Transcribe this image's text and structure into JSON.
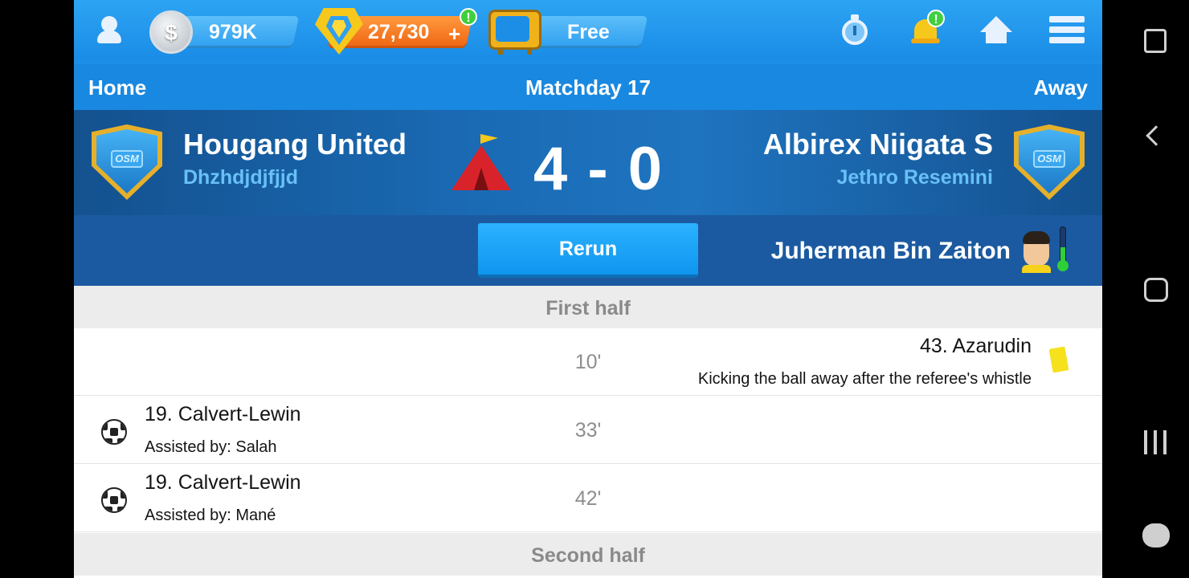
{
  "topbar": {
    "coins": "979K",
    "coin_symbol": "$",
    "gems": "27,730",
    "gems_plus": "+",
    "gems_alert": "!",
    "tv_label": "Free",
    "bell_alert": "!"
  },
  "match": {
    "home_label": "Home",
    "matchday": "Matchday 17",
    "away_label": "Away",
    "home_team": "Hougang United",
    "home_manager": "Dhzhdjdjfjjd",
    "away_team": "Albirex Niigata S",
    "away_manager": "Jethro Resemini",
    "score": "4 - 0",
    "badge_text": "OSM",
    "rerun_label": "Rerun",
    "man_of_match": "Juherman Bin Zaiton"
  },
  "sections": {
    "first_half": "First half",
    "second_half": "Second half"
  },
  "events": [
    {
      "minute": "10'",
      "side": "away",
      "type": "yellow-card",
      "title": "43. Azarudin",
      "detail": "Kicking the ball away after the referee's whistle"
    },
    {
      "minute": "33'",
      "side": "home",
      "type": "goal",
      "title": "19. Calvert-Lewin",
      "detail": "Assisted by: Salah"
    },
    {
      "minute": "42'",
      "side": "home",
      "type": "goal",
      "title": "19. Calvert-Lewin",
      "detail": "Assisted by: Mané"
    }
  ],
  "colors": {
    "topbar": "#1c8ee6",
    "score_band": "#1a6bb5",
    "rerun_button": "#0f95ee",
    "manager_text": "#68c0f7",
    "yellow_card": "#f5e11c"
  }
}
